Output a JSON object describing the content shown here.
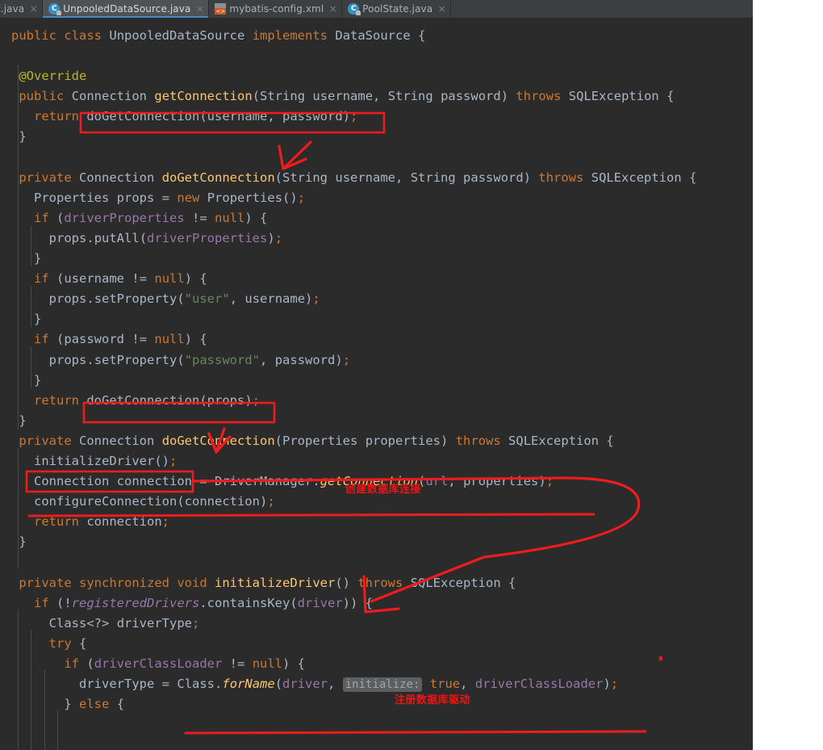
{
  "window": {
    "app": "IntelliJ IDEA code editor",
    "editor_background": "#2b2b2b",
    "page_background": "#ffffff",
    "annotation_color": "#ee1c1c"
  },
  "tabs": [
    {
      "label": "t.java",
      "icon": "java-class-icon",
      "active": false,
      "close_glyph": "×"
    },
    {
      "label": "UnpooledDataSource.java",
      "icon": "java-class-icon",
      "active": true,
      "close_glyph": "×"
    },
    {
      "label": "mybatis-config.xml",
      "icon": "xml-file-icon",
      "active": false,
      "close_glyph": "×"
    },
    {
      "label": "PoolState.java",
      "icon": "java-class-icon",
      "active": false,
      "close_glyph": "×"
    }
  ],
  "code": {
    "language": "java",
    "class_name": "UnpooledDataSource",
    "lines": [
      "public class UnpooledDataSource implements DataSource {",
      "",
      " @Override",
      " public Connection getConnection(String username, String password) throws SQLException {",
      "   return doGetConnection(username, password);",
      " }",
      "",
      " private Connection doGetConnection(String username, String password) throws SQLException {",
      "   Properties props = new Properties();",
      "   if (driverProperties != null) {",
      "     props.putAll(driverProperties);",
      "   }",
      "   if (username != null) {",
      "     props.setProperty(\"user\", username);",
      "   }",
      "   if (password != null) {",
      "     props.setProperty(\"password\", password);",
      "   }",
      "   return doGetConnection(props);",
      " }",
      " private Connection doGetConnection(Properties properties) throws SQLException {",
      "   initializeDriver();",
      "   Connection connection = DriverManager.getConnection(url, properties);",
      "   configureConnection(connection);",
      "   return connection;",
      " }",
      "",
      " private synchronized void initializeDriver() throws SQLException {",
      "   if (!registeredDrivers.containsKey(driver)) {",
      "     Class<?> driverType;",
      "     try {",
      "       if (driverClassLoader != null) {",
      "         driverType = Class.forName(driver, initialize: true, driverClassLoader);",
      "       } else {"
    ],
    "inlay_hints": [
      "initialize:"
    ],
    "token_colors": {
      "keyword": "#cc7832",
      "identifier": "#a9b7c6",
      "field": "#9876aa",
      "method": "#ffc66d",
      "string": "#6a8759",
      "annotation": "#bbb529",
      "inlay_hint_bg": "#5c5f61"
    }
  },
  "annotations": {
    "notes": [
      {
        "text": "创建数据库连接",
        "meaning": "create database connection"
      },
      {
        "text": "注册数据库驱动",
        "meaning": "register database driver"
      }
    ],
    "highlight_boxes": [
      "doGetConnection(username, password);",
      "doGetConnection(props);",
      "initializeDriver();"
    ],
    "underlines": [
      "Connection connection = DriverManager.getConnection(url, properties);",
      "driverType = Class.forName(driver, initialize: true, driverClassLoader);"
    ]
  }
}
